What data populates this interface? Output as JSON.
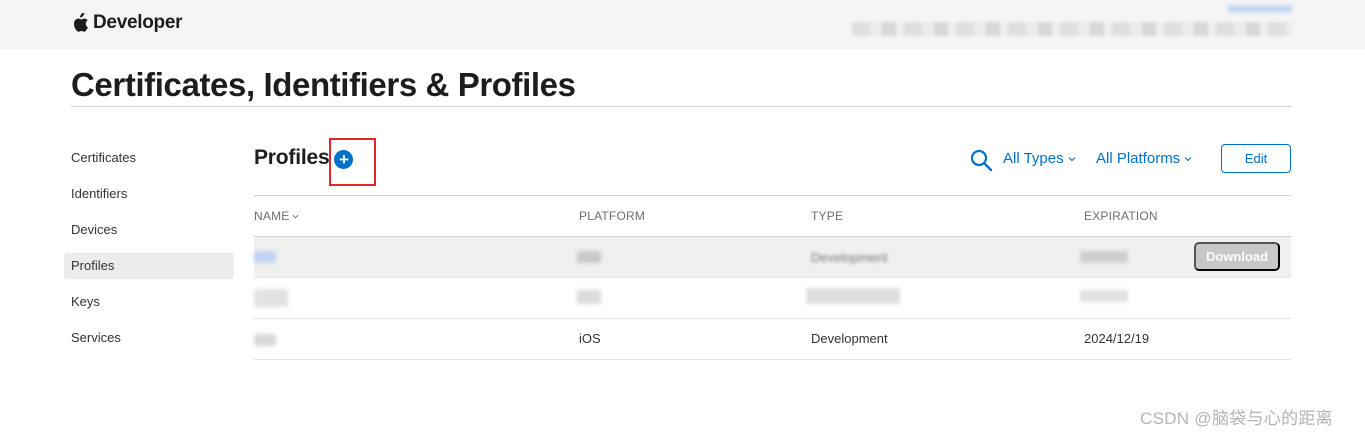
{
  "header": {
    "brand_icon": "apple-logo-icon",
    "brand_label": "Developer"
  },
  "page": {
    "title": "Certificates, Identifiers & Profiles"
  },
  "sidebar": {
    "items": [
      {
        "label": "Certificates",
        "active": false
      },
      {
        "label": "Identifiers",
        "active": false
      },
      {
        "label": "Devices",
        "active": false
      },
      {
        "label": "Profiles",
        "active": true
      },
      {
        "label": "Keys",
        "active": false
      },
      {
        "label": "Services",
        "active": false
      }
    ]
  },
  "section": {
    "title": "Profiles",
    "add_icon": "plus-circle-icon",
    "add_symbol": "+"
  },
  "toolbar": {
    "search_icon": "search-icon",
    "type_filter": "All Types",
    "platform_filter": "All Platforms",
    "edit_label": "Edit"
  },
  "table": {
    "columns": [
      "NAME",
      "PLATFORM",
      "TYPE",
      "EXPIRATION"
    ],
    "rows": [
      {
        "name": "",
        "platform": "",
        "type": "Development",
        "expiration": "",
        "download_label": "Download"
      },
      {
        "name": "",
        "platform": "",
        "type": "",
        "expiration": ""
      },
      {
        "name": "",
        "platform": "iOS",
        "type": "Development",
        "expiration": "2024/12/19"
      }
    ]
  },
  "watermark": "CSDN @脑袋与心的距离",
  "colors": {
    "accent": "#0070c9",
    "highlight": "#e3262b",
    "topbar": "#f5f5f7"
  }
}
